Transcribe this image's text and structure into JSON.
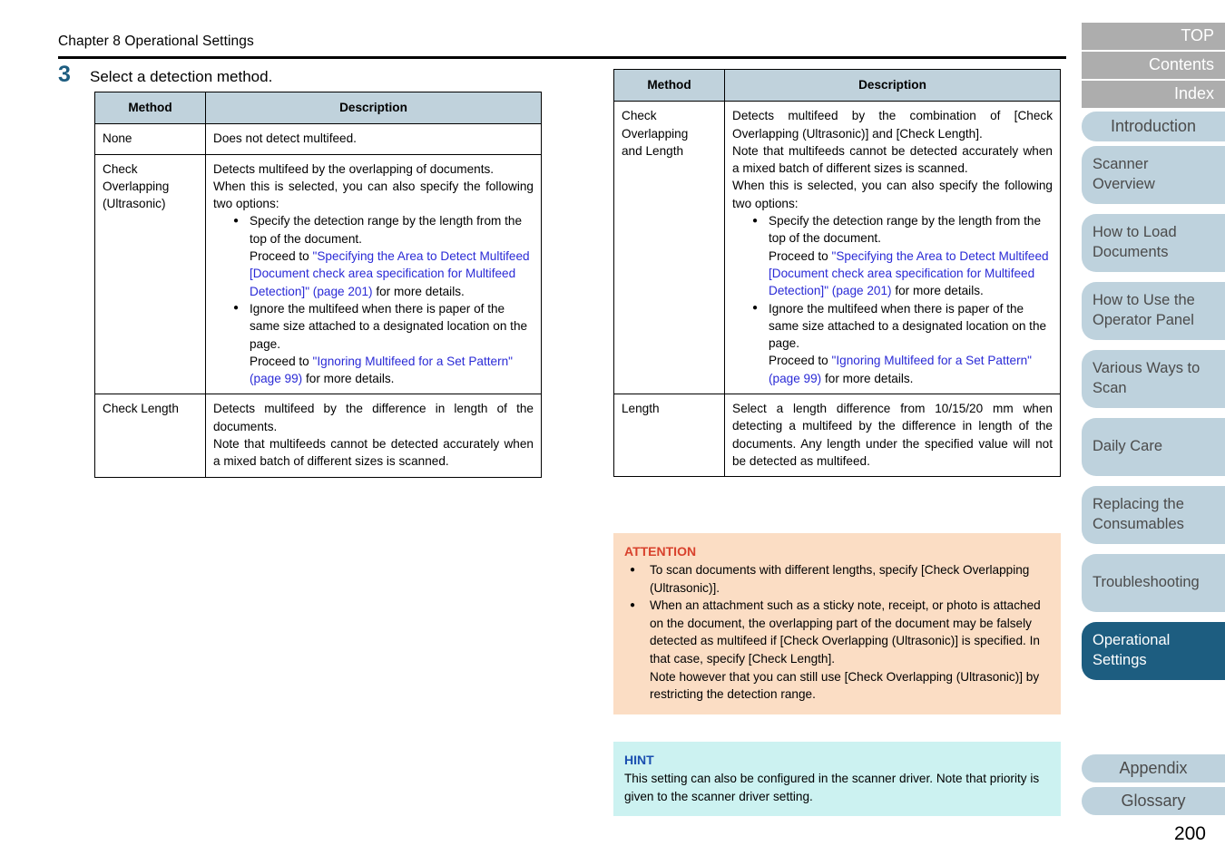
{
  "header": {
    "chapter": "Chapter 8 Operational Settings"
  },
  "step": {
    "number": "3",
    "text": "Select a detection method."
  },
  "tables": {
    "headers": {
      "method": "Method",
      "description": "Description"
    },
    "left_rows": [
      {
        "method": "None",
        "description_intro": "Does not detect multifeed."
      },
      {
        "method": "Check Overlapping (Ultrasonic)",
        "description_intro": "Detects multifeed by the overlapping of documents.\nWhen this is selected, you can also specify the following two options:",
        "bullets": [
          {
            "text": "Specify the detection range by the length from the top of the document.",
            "proceed_prefix": "Proceed to ",
            "link": "\"Specifying the Area to Detect Multifeed [Document check area specification for Multifeed Detection]\" (page 201)",
            "proceed_suffix": " for more details."
          },
          {
            "text": "Ignore the multifeed when there is paper of the same size attached to a designated location on the page.",
            "proceed_prefix": "Proceed to ",
            "link": "\"Ignoring Multifeed for a Set Pattern\" (page 99)",
            "proceed_suffix": " for more details."
          }
        ]
      },
      {
        "method": "Check Length",
        "description_intro": "Detects multifeed by the difference in length of the documents.\nNote that multifeeds cannot be detected accurately when a mixed batch of different sizes is scanned."
      }
    ],
    "right_rows": [
      {
        "method": "Check Overlapping and Length",
        "description_intro": "Detects multifeed by the combination of [Check Overlapping (Ultrasonic)] and [Check Length].\nNote that multifeeds cannot be detected accurately when a mixed batch of different sizes is scanned.\nWhen this is selected, you can also specify the following two options:",
        "bullets": [
          {
            "text": "Specify the detection range by the length from the top of the document.",
            "proceed_prefix": "Proceed to ",
            "link": "\"Specifying the Area to Detect Multifeed [Document check area specification for Multifeed Detection]\" (page 201)",
            "proceed_suffix": " for more details."
          },
          {
            "text": "Ignore the multifeed when there is paper of the same size attached to a designated location on the page.",
            "proceed_prefix": "Proceed to ",
            "link": "\"Ignoring Multifeed for a Set Pattern\" (page 99)",
            "proceed_suffix": " for more details."
          }
        ]
      },
      {
        "method": "Length",
        "description_intro": "Select a length difference from 10/15/20 mm when detecting a multifeed by the difference in length of the documents. Any length under the specified value will not be detected as multifeed."
      }
    ]
  },
  "attention": {
    "title": "ATTENTION",
    "bullets": [
      "To scan documents with different lengths, specify [Check Overlapping (Ultrasonic)].",
      "When an attachment such as a sticky note, receipt, or photo is attached on the document, the overlapping part of the document may be falsely detected as multifeed if [Check Overlapping (Ultrasonic)] is specified. In that case, specify [Check Length].\nNote however that you can still use [Check Overlapping (Ultrasonic)] by restricting the detection range."
    ]
  },
  "hint": {
    "title": "HINT",
    "body": "This setting can also be configured in the scanner driver. Note that priority is given to the scanner driver setting."
  },
  "nav": {
    "items": [
      {
        "label": "TOP",
        "style": "gray"
      },
      {
        "label": "Contents",
        "style": "gray"
      },
      {
        "label": "Index",
        "style": "gray"
      },
      {
        "label": "Introduction",
        "style": "blue-center"
      },
      {
        "label": "Scanner\nOverview",
        "style": "blue"
      },
      {
        "label": "How to Load\nDocuments",
        "style": "blue"
      },
      {
        "label": "How to Use the\nOperator Panel",
        "style": "blue"
      },
      {
        "label": "Various Ways to\nScan",
        "style": "blue"
      },
      {
        "label": "Daily Care",
        "style": "blue"
      },
      {
        "label": "Replacing the\nConsumables",
        "style": "blue"
      },
      {
        "label": "Troubleshooting",
        "style": "blue"
      },
      {
        "label": "Operational\nSettings",
        "style": "active"
      },
      {
        "label": "Appendix",
        "style": "blue-center"
      },
      {
        "label": "Glossary",
        "style": "blue-center"
      }
    ]
  },
  "page_number": "200",
  "colors": {
    "accent_dark_blue": "#1d5d80",
    "table_header_blue": "#c0d2dc",
    "link_blue": "#2a2ad6",
    "attention_bg": "#fbddc4",
    "attention_title": "#d8412c",
    "hint_bg": "#ccf2f1",
    "hint_title": "#1a4fb0",
    "nav_gray": "#adadad",
    "nav_blue": "#bed2dd"
  }
}
